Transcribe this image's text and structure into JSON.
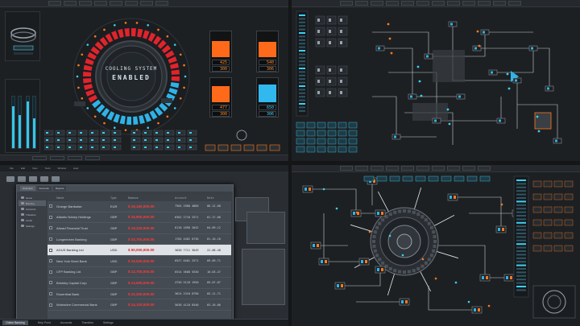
{
  "q1": {
    "dial_line1": "COOLING SYSTEM",
    "dial_line2": "ENABLED",
    "gauges": [
      {
        "top_value": "425",
        "bottom_value": "300",
        "level": 0.72,
        "color": "#ff6a1a"
      },
      {
        "top_value": "540",
        "bottom_value": "306",
        "level": 0.68,
        "color": "#ff6a1a"
      },
      {
        "top_value": "477",
        "bottom_value": "300",
        "level": 0.78,
        "color": "#ff6a1a"
      },
      {
        "top_value": "650",
        "bottom_value": "306",
        "level": 0.85,
        "color": "#31b8ee"
      }
    ],
    "vbars": [
      0.82,
      0.64,
      0.9,
      0.58
    ],
    "colors": {
      "red": "#e1242c",
      "blue": "#2fb3e6",
      "orange": "#ff7a1c",
      "cyan": "#3ad2f2"
    }
  },
  "q3": {
    "toolbar_items": [
      "File",
      "Edit",
      "View",
      "Tools",
      "Window",
      "Help"
    ],
    "tabs": [
      "Overview",
      "Accounts",
      "Reports"
    ],
    "side_items": [
      "Home",
      "Banking",
      "Accounts",
      "Transfers",
      "Cards",
      "Settings"
    ],
    "headers": [
      "Name",
      "Type",
      "Balance",
      "Account",
      "Date"
    ],
    "rows": [
      {
        "name": "Orange Bankwise",
        "type": "EUR",
        "balance": "$ 18,160,000.00",
        "account": "7564 2908 4866",
        "date": "06-12-08",
        "selected": false
      },
      {
        "name": "Atlantic Notary Holdings",
        "type": "GBP",
        "balance": "$ 16,900,000.00",
        "account": "6302 2718 2571",
        "date": "01-17-06",
        "selected": false
      },
      {
        "name": "Ahead Financial Trust",
        "type": "GBP",
        "balance": "$ 18,320,000.00",
        "account": "6118 1890 2042",
        "date": "04-09-12",
        "selected": false
      },
      {
        "name": "Longenheim Banking",
        "type": "GBP",
        "balance": "$ 33,750,000.00",
        "account": "1704 4402 0730",
        "date": "01-10-10",
        "selected": false
      },
      {
        "name": "AGUS Banking Ltd",
        "type": "USD",
        "balance": "$ 50,000,000.00",
        "account": "3658 7711 3649",
        "date": "22-08-48",
        "selected": true
      },
      {
        "name": "New York Word Bank",
        "type": "USD",
        "balance": "$ 19,520,000.00",
        "account": "6527 6481 2571",
        "date": "09-09-71",
        "selected": false
      },
      {
        "name": "CFP Banking Ltd",
        "type": "GBP",
        "balance": "$ 12,700,000.00",
        "account": "6514 3608 5530",
        "date": "10-03-47",
        "selected": false
      },
      {
        "name": "Brinkley Capital Corp",
        "type": "GBP",
        "balance": "$ 13,600,000.00",
        "account": "4750 5118 1950",
        "date": "05-07-07",
        "selected": false
      },
      {
        "name": "Rosenthal Bank",
        "type": "GBP",
        "balance": "$ 22,320,000.00",
        "account": "3624 2310 8790",
        "date": "05-11-71",
        "selected": false
      },
      {
        "name": "Workshire Commercial Bank",
        "type": "GBP",
        "balance": "$ 14,120,000.00",
        "account": "5638 4118 6540",
        "date": "03-10-06",
        "selected": false
      }
    ],
    "status_items": [
      "Online Banking",
      "Help Point",
      "Accounts",
      "Transfers",
      "Settings"
    ]
  }
}
